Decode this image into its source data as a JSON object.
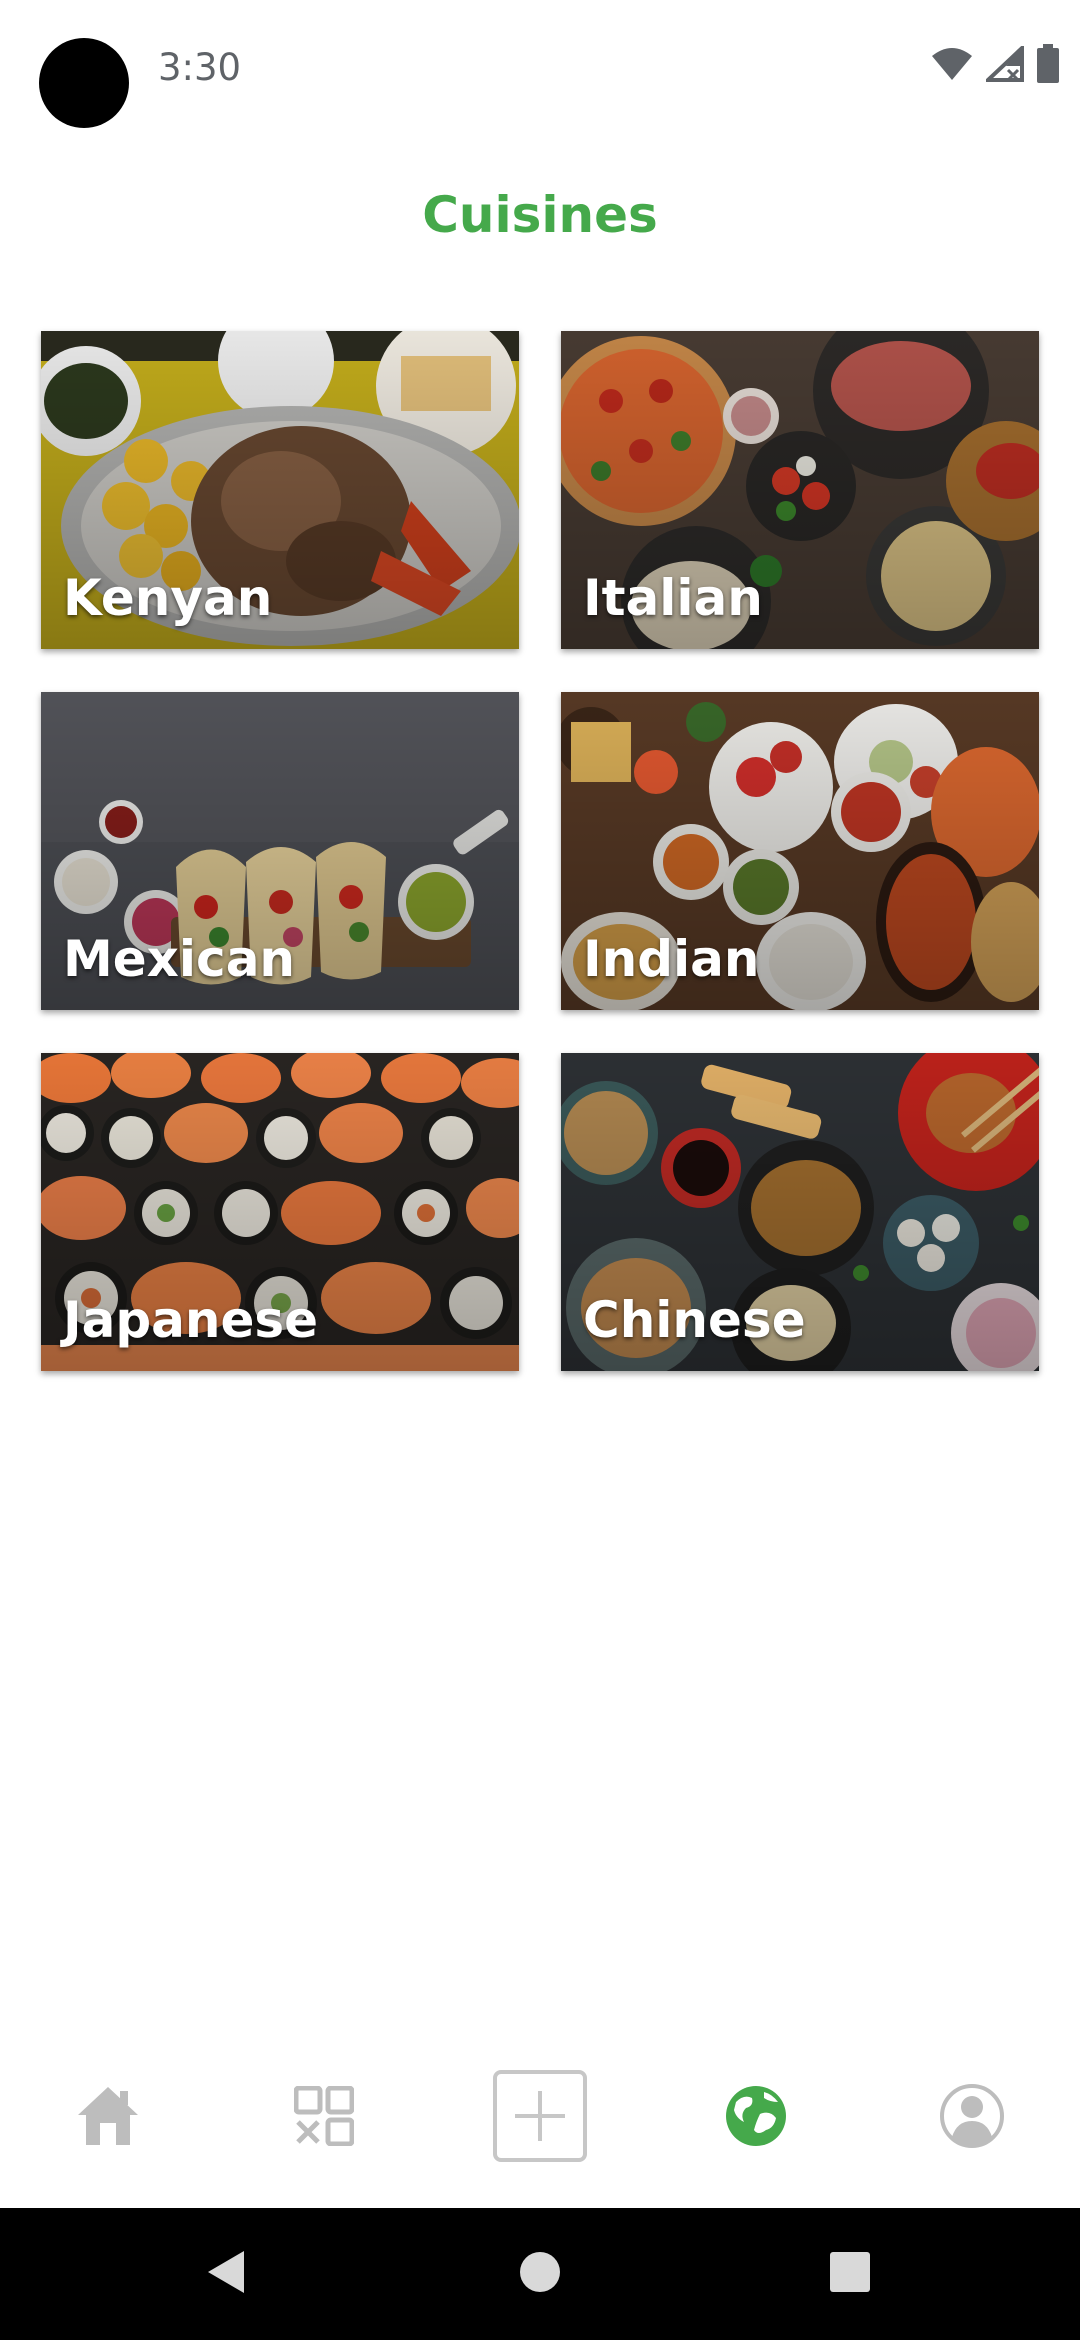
{
  "status_bar": {
    "time": "3:30",
    "icons": [
      "wifi-icon",
      "signal-off-icon",
      "battery-icon"
    ]
  },
  "page": {
    "title": "Cuisines",
    "accent_color": "#45a94b"
  },
  "cuisines": [
    {
      "label": "Kenyan"
    },
    {
      "label": "Italian"
    },
    {
      "label": "Mexican"
    },
    {
      "label": "Indian"
    },
    {
      "label": "Japanese"
    },
    {
      "label": "Chinese"
    }
  ],
  "bottom_nav": {
    "items": [
      {
        "icon": "home-icon",
        "active": false
      },
      {
        "icon": "categories-grid-icon",
        "active": false
      },
      {
        "icon": "add-icon",
        "active": false
      },
      {
        "icon": "globe-icon",
        "active": true
      },
      {
        "icon": "profile-icon",
        "active": false
      }
    ]
  },
  "system_nav": {
    "buttons": [
      "back-icon",
      "home-circle-icon",
      "recents-icon"
    ]
  }
}
